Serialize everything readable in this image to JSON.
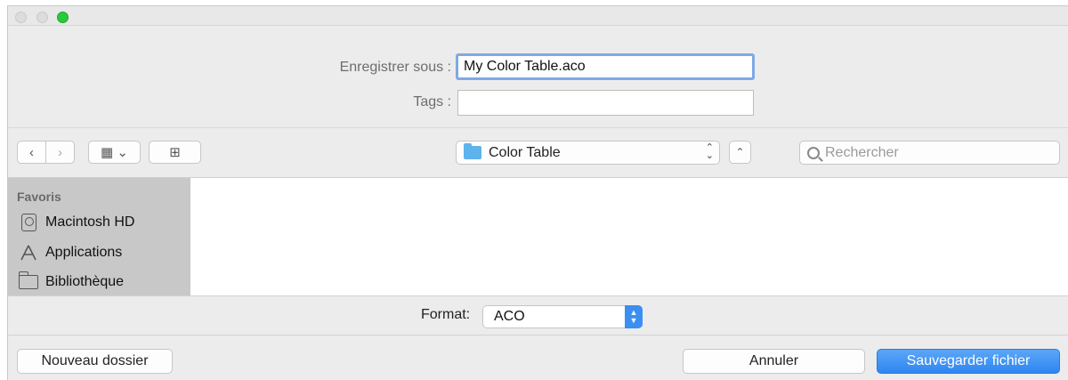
{
  "dialog": {
    "save_as_label": "Enregistrer sous :",
    "filename_value": "My Color Table.aco",
    "tags_label": "Tags :",
    "tags_value": ""
  },
  "toolbar": {
    "back_glyph": "‹",
    "forward_glyph": "›",
    "view_glyph": "▦ ⌄",
    "new_folder_glyph": "⊞",
    "location": "Color Table",
    "up_glyph": "⌃",
    "search_placeholder": "Rechercher"
  },
  "sidebar": {
    "heading": "Favoris",
    "items": [
      {
        "label": "Macintosh HD",
        "icon": "hard-drive-icon"
      },
      {
        "label": "Applications",
        "icon": "applications-icon"
      },
      {
        "label": "Bibliothèque",
        "icon": "folder-icon"
      }
    ]
  },
  "format": {
    "label": "Format:",
    "value": "ACO"
  },
  "buttons": {
    "new_folder": "Nouveau dossier",
    "cancel": "Annuler",
    "save": "Sauvegarder fichier"
  },
  "colors": {
    "accent": "#3b8ff3",
    "traffic_green": "#28c840",
    "folder_blue": "#5fb3ec"
  }
}
